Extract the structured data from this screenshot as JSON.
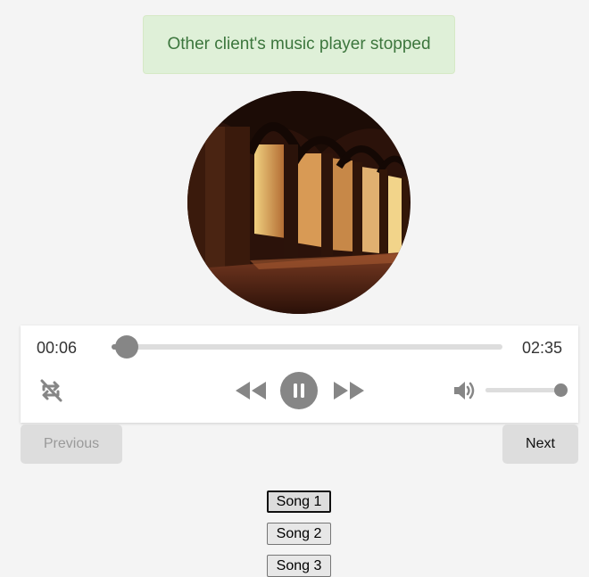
{
  "notification": {
    "message": "Other client's music player stopped",
    "color": "#3c763d",
    "background": "#dff0d8"
  },
  "cover": {
    "icon": "album-art-image"
  },
  "player": {
    "current_time": "00:06",
    "total_time": "02:35",
    "progress_fraction": 0.039,
    "volume_fraction": 1.0,
    "controls": {
      "loop": "repeat-off-icon",
      "rewind": "rewind-icon",
      "play_state": "pause-icon",
      "forward": "fast-forward-icon",
      "volume": "volume-icon"
    },
    "accent_color": "#868686"
  },
  "nav": {
    "previous_label": "Previous",
    "next_label": "Next"
  },
  "playlist": [
    {
      "label": "Song 1",
      "active": true
    },
    {
      "label": "Song 2",
      "active": false
    },
    {
      "label": "Song 3",
      "active": false
    }
  ]
}
